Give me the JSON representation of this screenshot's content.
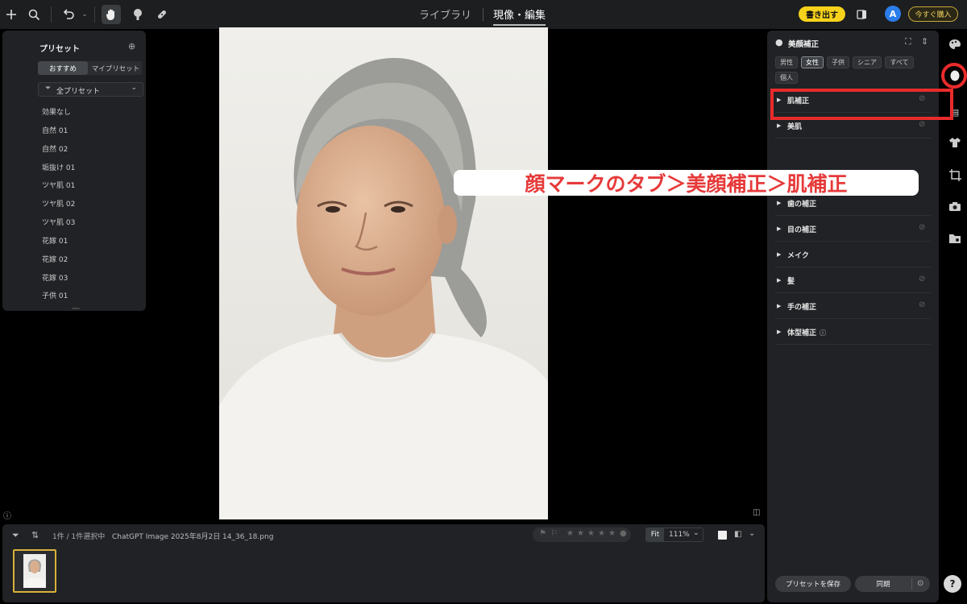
{
  "topbar": {
    "icons": [
      "plus-icon",
      "search-icon",
      "undo-icon",
      "hand-icon",
      "face-brush-icon",
      "bandage-icon"
    ],
    "library_tab": "ライブラリ",
    "develop_tab": "現像・編集",
    "export_label": "書き出す",
    "avatar_letter": "A",
    "buy_label": "今すぐ購入"
  },
  "presets": {
    "title": "プリセット",
    "tabs": [
      "おすすめ",
      "マイプリセット"
    ],
    "filter_label": "全プリセット",
    "items": [
      "効果なし",
      "自然 01",
      "自然 02",
      "垢抜け 01",
      "ツヤ肌 01",
      "ツヤ肌 02",
      "ツヤ肌 03",
      "花嫁 01",
      "花嫁 02",
      "花嫁 03",
      "子供 01"
    ]
  },
  "filmstrip": {
    "count": "1件 / 1件選択中",
    "filename": "ChatGPT Image 2025年8月2日 14_36_18.png",
    "rating_stars": 0,
    "zoom_fit": "Fit",
    "zoom_value": "111%"
  },
  "beauty": {
    "title": "美顔補正",
    "chips": [
      "男性",
      "女性",
      "子供",
      "シニア",
      "すべて",
      "個人"
    ],
    "selected_chip": "女性",
    "sections": [
      "肌補正",
      "美肌",
      "歯の補正",
      "目の補正",
      "メイク",
      "髪",
      "手の補正",
      "体型補正"
    ],
    "save_preset": "プリセットを保存",
    "sync": "同期"
  },
  "annotation": {
    "callout": "顔マークのタブ＞美顔補正＞肌補正",
    "color": "#e92b2b"
  },
  "help_label": "?"
}
